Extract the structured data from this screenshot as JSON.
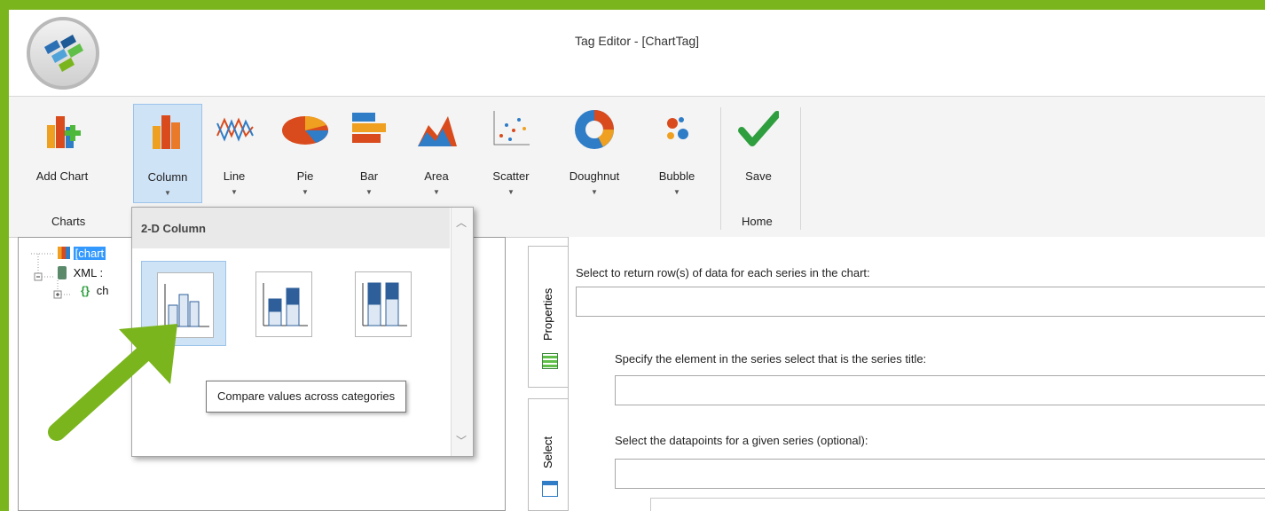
{
  "window": {
    "title": "Tag Editor - [ChartTag]"
  },
  "ribbon": {
    "buttons": [
      {
        "label": "Add Chart",
        "icon": "add-chart-icon",
        "has_dropdown": false
      },
      {
        "label": "Column",
        "icon": "column-chart-icon",
        "has_dropdown": true
      },
      {
        "label": "Line",
        "icon": "line-chart-icon",
        "has_dropdown": true
      },
      {
        "label": "Pie",
        "icon": "pie-chart-icon",
        "has_dropdown": true
      },
      {
        "label": "Bar",
        "icon": "bar-chart-icon",
        "has_dropdown": true
      },
      {
        "label": "Area",
        "icon": "area-chart-icon",
        "has_dropdown": true
      },
      {
        "label": "Scatter",
        "icon": "scatter-chart-icon",
        "has_dropdown": true
      },
      {
        "label": "Doughnut",
        "icon": "doughnut-chart-icon",
        "has_dropdown": true
      },
      {
        "label": "Bubble",
        "icon": "bubble-chart-icon",
        "has_dropdown": true
      },
      {
        "label": "Save",
        "icon": "checkmark-icon",
        "has_dropdown": false
      }
    ],
    "groups": {
      "charts": "Charts",
      "home": "Home"
    }
  },
  "tree": {
    "items": [
      {
        "label": "[chart",
        "icon": "chart-node-icon",
        "selected": true
      },
      {
        "label": "XML :",
        "icon": "database-icon",
        "selected": false
      },
      {
        "label": "ch",
        "icon": "braces-icon",
        "selected": false
      }
    ]
  },
  "dropdown": {
    "header": "2-D Column",
    "options": [
      {
        "name": "clustered-column",
        "hover": true
      },
      {
        "name": "stacked-column",
        "hover": false
      },
      {
        "name": "100-stacked-column",
        "hover": false
      }
    ],
    "tooltip": "Compare values across categories"
  },
  "side_tabs": {
    "properties": "Properties",
    "select": "Select"
  },
  "form": {
    "series_label": "Select to return row(s) of data for each series in the chart:",
    "title_label": "Specify the element in the series select that is the series title:",
    "datapoints_label": "Select the datapoints for a given series (optional):",
    "series_value": "",
    "title_value": "",
    "datapoints_value": ""
  },
  "colors": {
    "frame_green": "#7ab51d",
    "arrow_green": "#7ab51d",
    "selection_blue": "#3399ff"
  }
}
